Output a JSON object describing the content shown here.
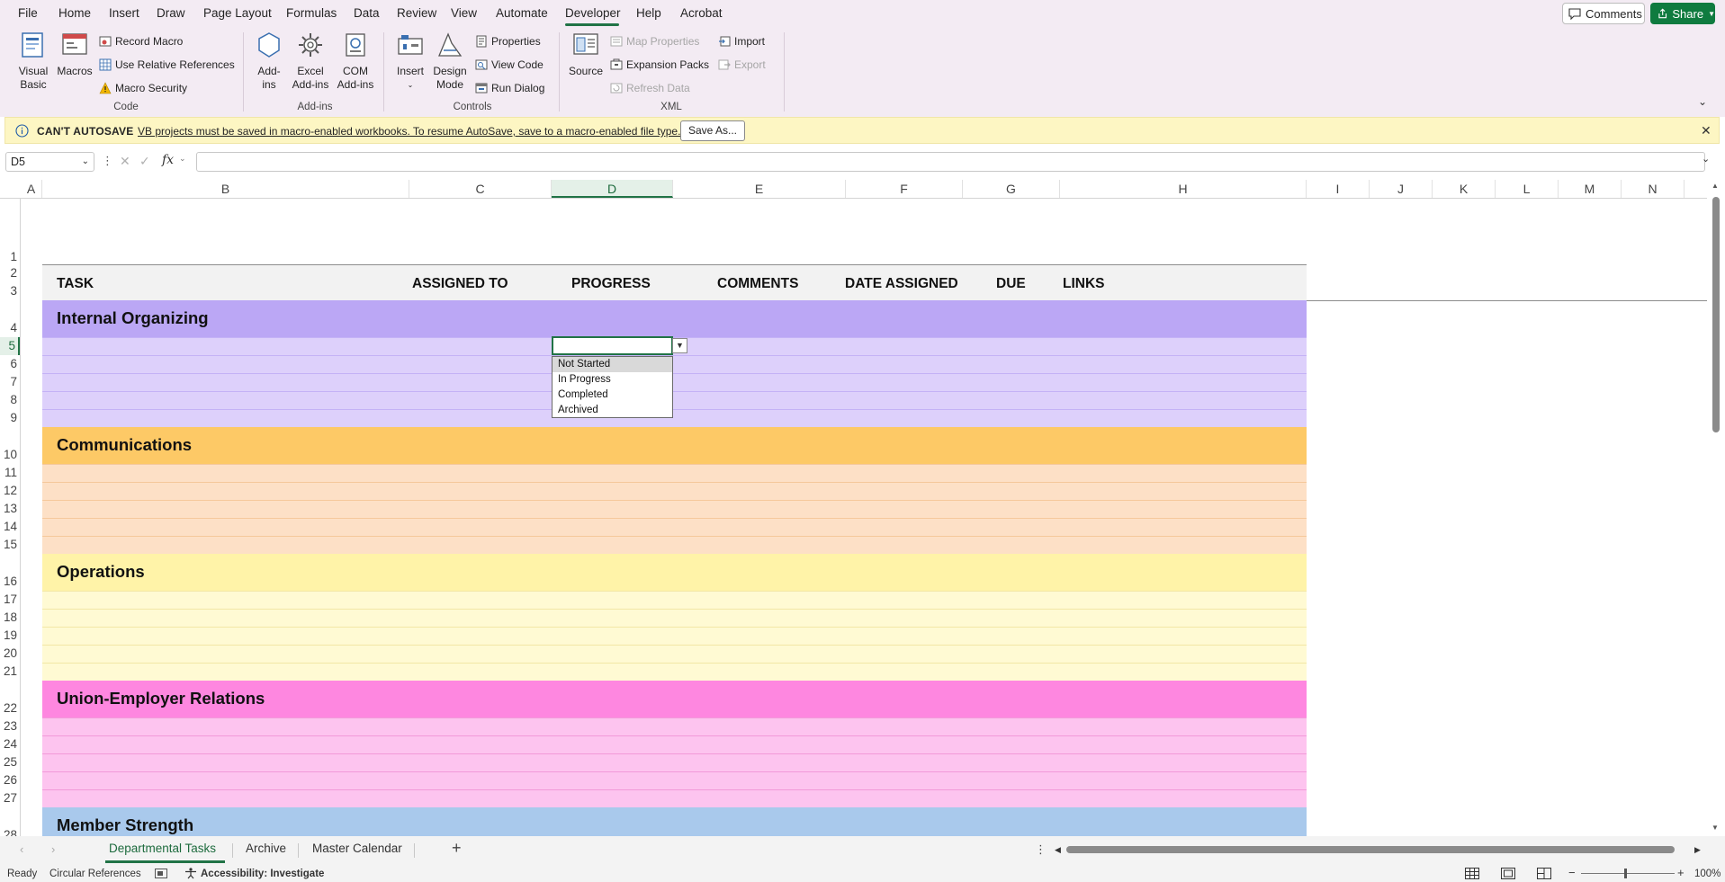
{
  "menu": {
    "items": [
      "File",
      "Home",
      "Insert",
      "Draw",
      "Page Layout",
      "Formulas",
      "Data",
      "Review",
      "View",
      "Automate",
      "Developer",
      "Help",
      "Acrobat"
    ],
    "active": "Developer",
    "comments_label": "Comments",
    "share_label": "Share"
  },
  "ribbon": {
    "code": {
      "visual_basic": "Visual\nBasic",
      "macros": "Macros",
      "record_macro": "Record Macro",
      "use_relative": "Use Relative References",
      "macro_security": "Macro Security",
      "label": "Code"
    },
    "addins": {
      "addins": "Add-\nins",
      "excel_addins": "Excel\nAdd-ins",
      "com_addins": "COM\nAdd-ins",
      "label": "Add-ins"
    },
    "controls": {
      "insert": "Insert",
      "design_mode": "Design\nMode",
      "properties": "Properties",
      "view_code": "View Code",
      "run_dialog": "Run Dialog",
      "label": "Controls"
    },
    "xml": {
      "source": "Source",
      "map_properties": "Map Properties",
      "expansion_packs": "Expansion Packs",
      "refresh_data": "Refresh Data",
      "import": "Import",
      "export": "Export",
      "label": "XML"
    }
  },
  "infobar": {
    "title": "CAN'T AUTOSAVE",
    "message": "VB projects must be saved in macro-enabled workbooks. To resume AutoSave, save to a macro-enabled file type.",
    "save_as": "Save As..."
  },
  "formula_bar": {
    "name_box": "D5",
    "fx": "fx",
    "content": ""
  },
  "columns": [
    "A",
    "B",
    "C",
    "D",
    "E",
    "F",
    "G",
    "H",
    "I",
    "J",
    "K",
    "L",
    "M",
    "N"
  ],
  "selected_column": "D",
  "rows": [
    "1",
    "2",
    "3",
    "4",
    "5",
    "6",
    "7",
    "8",
    "9",
    "10",
    "11",
    "12",
    "13",
    "14",
    "15",
    "16",
    "17",
    "18",
    "19",
    "20",
    "21",
    "22",
    "23",
    "24",
    "25",
    "26",
    "27",
    "28"
  ],
  "selected_row": "5",
  "table_headers": {
    "task": "TASK",
    "assigned_to": "ASSIGNED TO",
    "progress": "PROGRESS",
    "comments": "COMMENTS",
    "date_assigned": "DATE ASSIGNED",
    "due": "DUE",
    "links": "LINKS"
  },
  "sections": [
    {
      "title": "Internal Organizing",
      "header_color": "#bba7f5",
      "row_color": "#ddd0fb",
      "line_color": "#c4b2f6"
    },
    {
      "title": "Communications",
      "header_color": "#fdc966",
      "row_color": "#fde0c6",
      "line_color": "#f5c89b"
    },
    {
      "title": "Operations",
      "header_color": "#fff3a8",
      "row_color": "#fffad3",
      "line_color": "#f2e7a6"
    },
    {
      "title": "Union-Employer Relations",
      "header_color": "#fe87e0",
      "row_color": "#fdc4ef",
      "line_color": "#f29ad9"
    },
    {
      "title": "Member Strength",
      "header_color": "#a9c9ec",
      "row_color": "#d4e5f6",
      "line_color": "#a9c9ec"
    }
  ],
  "dropdown": {
    "options": [
      "Not Started",
      "In Progress",
      "Completed",
      "Archived"
    ],
    "highlighted": "Not Started"
  },
  "sheet_tabs": [
    "Departmental Tasks",
    "Archive",
    "Master Calendar"
  ],
  "active_tab": "Departmental Tasks",
  "status": {
    "ready": "Ready",
    "circular": "Circular References",
    "accessibility": "Accessibility: Investigate",
    "zoom": "100%"
  },
  "colors": {
    "accent": "#217346",
    "share": "#0f7b3f"
  }
}
